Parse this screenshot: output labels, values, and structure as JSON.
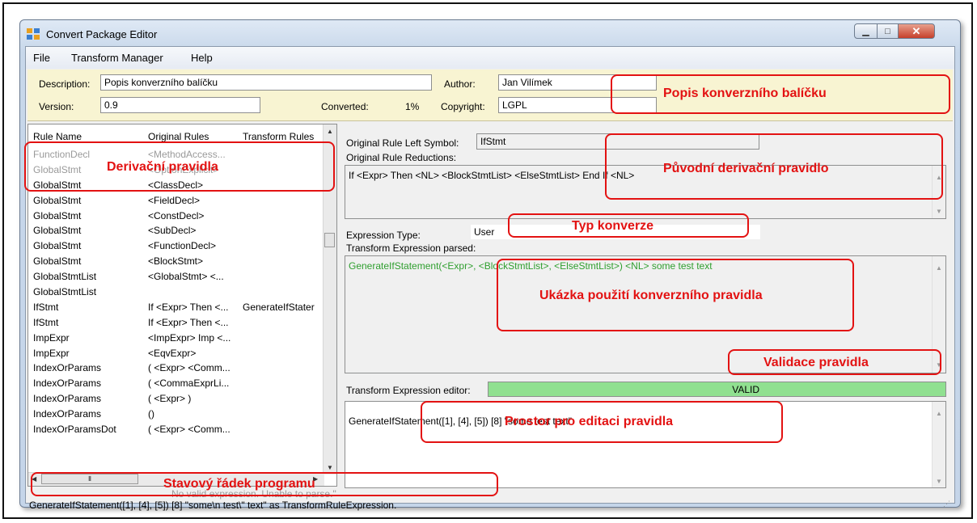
{
  "window": {
    "title": "Convert Package Editor"
  },
  "menu": [
    "File",
    "Transform Manager",
    "Help"
  ],
  "package": {
    "description_label": "Description:",
    "description": "Popis konverzního balíčku",
    "author_label": "Author:",
    "author": "Jan Vilímek",
    "version_label": "Version:",
    "version": "0.9",
    "converted_label": "Converted:",
    "converted": "1%",
    "copyright_label": "Copyright:",
    "copyright": "LGPL"
  },
  "rule_list": {
    "columns": [
      "Rule Name",
      "Original Rules",
      "Transform Rules"
    ],
    "rows": [
      [
        "FunctionDecl",
        "<MethodAccess...",
        ""
      ],
      [
        "GlobalStmt",
        "<OptionExplicit>",
        ""
      ],
      [
        "GlobalStmt",
        "<ClassDecl>",
        ""
      ],
      [
        "GlobalStmt",
        "<FieldDecl>",
        ""
      ],
      [
        "GlobalStmt",
        "<ConstDecl>",
        ""
      ],
      [
        "GlobalStmt",
        "<SubDecl>",
        ""
      ],
      [
        "GlobalStmt",
        "<FunctionDecl>",
        ""
      ],
      [
        "GlobalStmt",
        "<BlockStmt>",
        ""
      ],
      [
        "GlobalStmtList",
        "<GlobalStmt> <...",
        ""
      ],
      [
        "GlobalStmtList",
        "",
        ""
      ],
      [
        "IfStmt",
        "If <Expr> Then <...",
        "GenerateIfStater"
      ],
      [
        "IfStmt",
        "If <Expr> Then <...",
        ""
      ],
      [
        "ImpExpr",
        "<ImpExpr> Imp <...",
        ""
      ],
      [
        "ImpExpr",
        "<EqvExpr>",
        ""
      ],
      [
        "IndexOrParams",
        "( <Expr> <Comm...",
        ""
      ],
      [
        "IndexOrParams",
        "( <CommaExprLi...",
        ""
      ],
      [
        "IndexOrParams",
        "( <Expr> )",
        ""
      ],
      [
        "IndexOrParams",
        "()",
        ""
      ],
      [
        "IndexOrParamsDot",
        "( <Expr> <Comm...",
        ""
      ]
    ]
  },
  "rule_detail": {
    "left_symbol_label": "Original Rule Left Symbol:",
    "left_symbol": "IfStmt",
    "reductions_label": "Original Rule Reductions:",
    "reductions": "If <Expr> Then <NL> <BlockStmtList> <ElseStmtList> End If <NL>",
    "expression_type_label": "Expression Type:",
    "expression_type": "User",
    "parsed_label": "Transform Expression parsed:",
    "parsed": "GenerateIfStatement(<Expr>, <BlockStmtList>, <ElseStmtList>) <NL> some test text",
    "editor_label": "Transform Expression editor:",
    "validation": "VALID",
    "editor_text": "GenerateIfStatement([1], [4], [5])        [8] \"some test text\""
  },
  "status": {
    "line1": "No valid expression. Unable to parse.\"",
    "line2": "GenerateIfStatement([1], [4], [5])        [8] \"some\\n test\\\" text\" as TransformRuleExpression."
  },
  "annotations": [
    "Popis konverzního balíčku",
    "Derivační pravidla",
    "Původní derivační pravidlo",
    "Typ konverze",
    "Ukázka použití konverzního pravidla",
    "Validace pravidla",
    "Prostor pro editaci pravidla",
    "Stavový řádek programu"
  ],
  "colors": {
    "annotation": "#e31212",
    "valid_bg": "#90e090",
    "description_bg": "#f8f4d2",
    "parsed_text": "#2f9f2f"
  }
}
